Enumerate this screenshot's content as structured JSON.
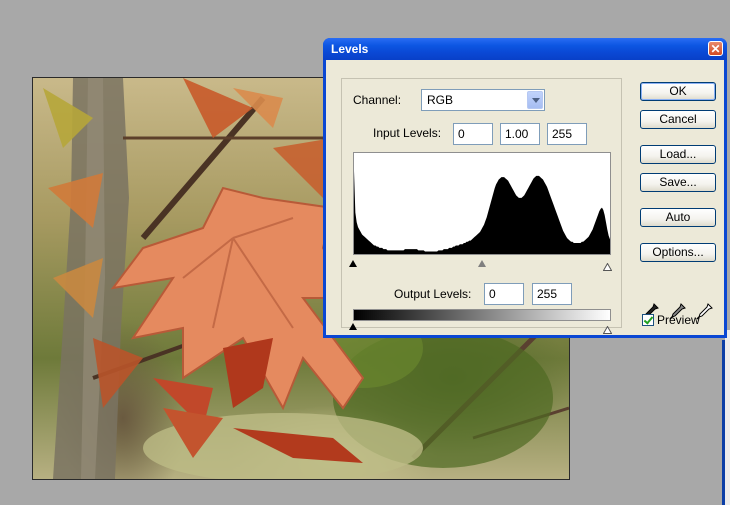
{
  "dialog": {
    "title": "Levels",
    "close_glyph": "✕"
  },
  "channel": {
    "label": "Channel:",
    "value": "RGB"
  },
  "input_levels": {
    "label": "Input Levels:",
    "black": "0",
    "gamma": "1.00",
    "white": "255"
  },
  "output_levels": {
    "label": "Output Levels:",
    "black": "0",
    "white": "255"
  },
  "buttons": {
    "ok": "OK",
    "cancel": "Cancel",
    "load": "Load...",
    "save": "Save...",
    "auto": "Auto",
    "options": "Options..."
  },
  "preview": {
    "label": "Preview",
    "checked": true
  },
  "icons": [
    "black-point-eyedropper-icon",
    "gray-point-eyedropper-icon",
    "white-point-eyedropper-icon"
  ],
  "histogram": [
    68,
    34,
    26,
    22,
    20,
    18,
    16,
    15,
    14,
    13,
    12,
    11,
    10,
    9,
    8,
    7,
    7,
    6,
    6,
    5,
    5,
    5,
    4,
    4,
    4,
    3,
    3,
    3,
    3,
    3,
    3,
    3,
    3,
    3,
    3,
    3,
    3,
    3,
    4,
    4,
    4,
    4,
    4,
    4,
    4,
    4,
    4,
    4,
    3,
    3,
    3,
    3,
    3,
    2,
    2,
    2,
    2,
    2,
    2,
    2,
    2,
    2,
    2,
    3,
    3,
    3,
    3,
    4,
    4,
    4,
    4,
    5,
    5,
    5,
    6,
    6,
    7,
    7,
    7,
    8,
    8,
    8,
    9,
    9,
    10,
    10,
    11,
    11,
    12,
    13,
    14,
    15,
    16,
    17,
    18,
    20,
    22,
    24,
    27,
    30,
    34,
    38,
    42,
    46,
    50,
    54,
    57,
    59,
    61,
    62,
    63,
    63,
    63,
    62,
    61,
    60,
    58,
    56,
    54,
    52,
    50,
    48,
    47,
    46,
    46,
    46,
    47,
    48,
    50,
    52,
    54,
    56,
    58,
    60,
    62,
    63,
    64,
    64,
    64,
    63,
    62,
    61,
    59,
    57,
    55,
    52,
    49,
    46,
    43,
    40,
    37,
    34,
    31,
    28,
    25,
    22,
    19,
    17,
    15,
    13,
    12,
    11,
    10,
    10,
    9,
    9,
    9,
    9,
    9,
    9,
    10,
    10,
    11,
    12,
    13,
    14,
    16,
    18,
    20,
    23,
    26,
    29,
    32,
    35,
    37,
    38,
    36,
    32,
    26,
    20,
    15,
    12
  ]
}
